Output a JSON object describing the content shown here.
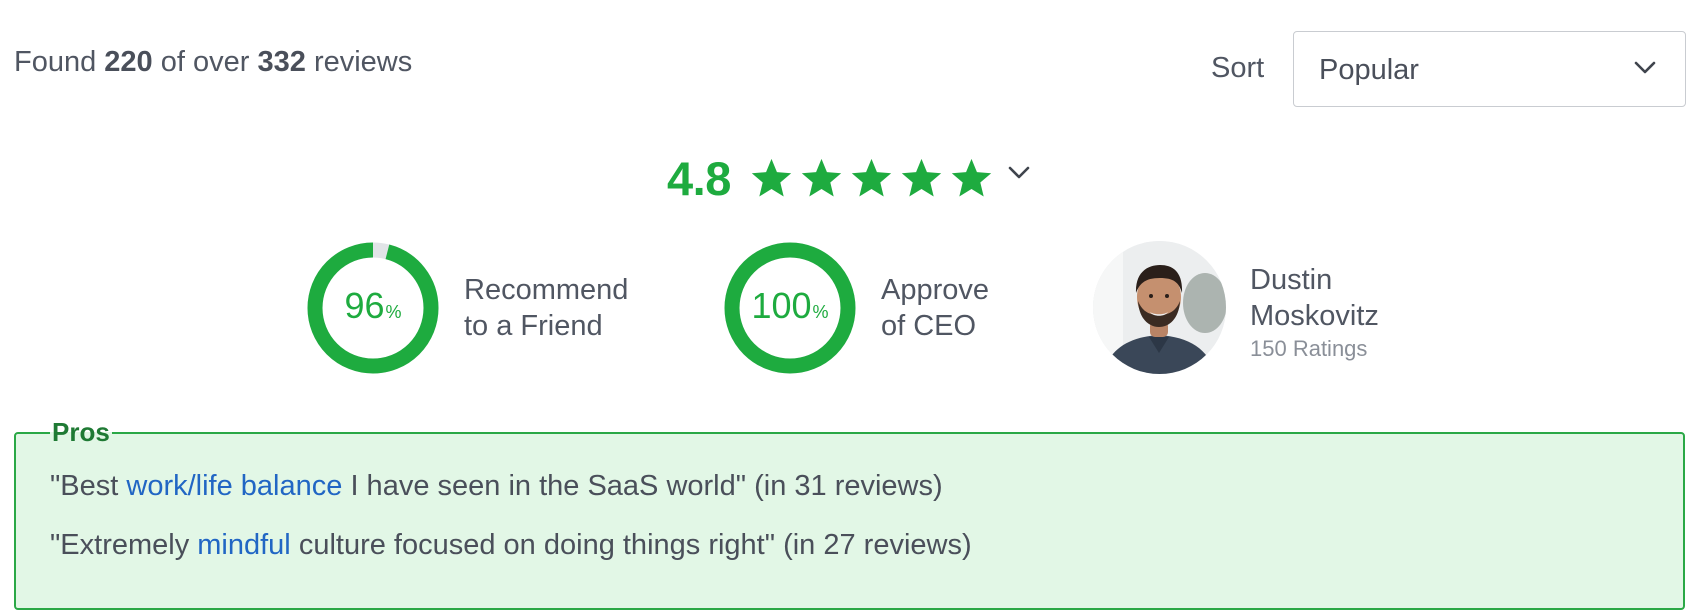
{
  "header": {
    "found_prefix": "Found",
    "found_count": "220",
    "found_middle": "of over",
    "total_count": "332",
    "found_suffix": "reviews"
  },
  "sort": {
    "label": "Sort",
    "selected": "Popular",
    "icon": "chevron-down-icon"
  },
  "rating": {
    "value": "4.8",
    "stars": 5,
    "star_icon": "star-icon",
    "expand_icon": "chevron-down-icon",
    "accent": "#1eab3f"
  },
  "stats": {
    "recommend": {
      "percent": 96,
      "value": "96",
      "unit": "%",
      "label_line1": "Recommend",
      "label_line2": "to a Friend"
    },
    "ceo_approval": {
      "percent": 100,
      "value": "100",
      "unit": "%",
      "label_line1": "Approve",
      "label_line2": "of CEO"
    }
  },
  "ceo": {
    "name_line1": "Dustin",
    "name_line2": "Moskovitz",
    "ratings": "150 Ratings"
  },
  "pros": {
    "title": "Pros",
    "items": [
      {
        "before": "\"Best ",
        "keyword": "work/life balance",
        "after": " I have seen in the SaaS world\" (in 31 reviews)"
      },
      {
        "before": "\"Extremely ",
        "keyword": "mindful",
        "after": " culture focused on doing things right\" (in 27 reviews)"
      }
    ]
  },
  "colors": {
    "green": "#1eab3f",
    "link_blue": "#2166c4",
    "pros_bg": "#e2f7e6",
    "pros_border": "#2aa846"
  }
}
